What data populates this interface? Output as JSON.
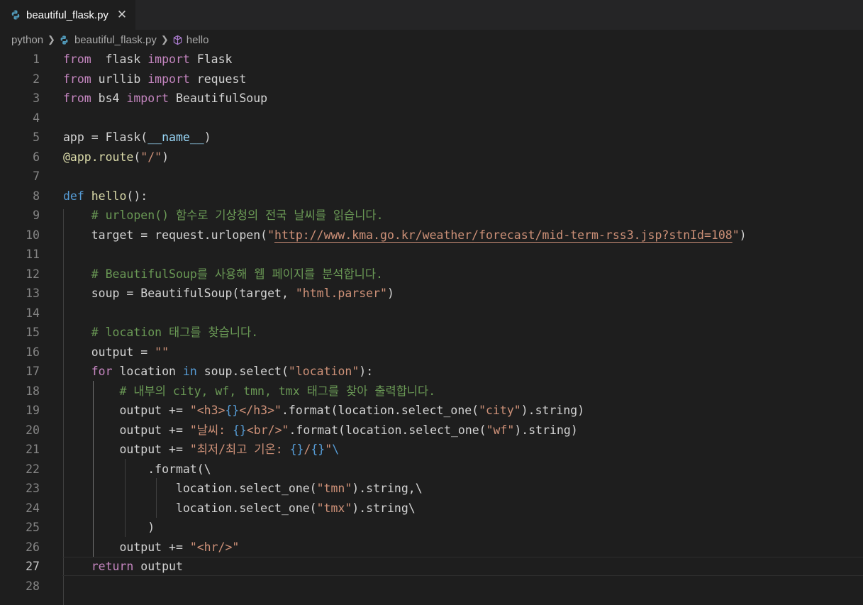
{
  "tab": {
    "filename": "beautiful_flask.py",
    "close_glyph": "✕",
    "icon": "python-icon"
  },
  "breadcrumb": {
    "folder": "python",
    "file": "beautiful_flask.py",
    "symbol": "hello"
  },
  "editor": {
    "current_line": 27,
    "lines": [
      {
        "n": "1",
        "tokens": [
          [
            "kw",
            "from"
          ],
          [
            "",
            "  flask "
          ],
          [
            "kw",
            "import"
          ],
          [
            "",
            " Flask"
          ]
        ]
      },
      {
        "n": "2",
        "tokens": [
          [
            "kw",
            "from"
          ],
          [
            "",
            " urllib "
          ],
          [
            "kw",
            "import"
          ],
          [
            "",
            " request"
          ]
        ]
      },
      {
        "n": "3",
        "tokens": [
          [
            "kw",
            "from"
          ],
          [
            "",
            " bs4 "
          ],
          [
            "kw",
            "import"
          ],
          [
            "",
            " BeautifulSoup"
          ]
        ]
      },
      {
        "n": "4",
        "tokens": []
      },
      {
        "n": "5",
        "tokens": [
          [
            "",
            "app = Flask("
          ],
          [
            "var",
            "__name__"
          ],
          [
            "",
            ")"
          ]
        ]
      },
      {
        "n": "6",
        "tokens": [
          [
            "fn",
            "@app.route"
          ],
          [
            "",
            "("
          ],
          [
            "str",
            "\"/\""
          ],
          [
            "",
            ")"
          ]
        ]
      },
      {
        "n": "7",
        "tokens": []
      },
      {
        "n": "8",
        "tokens": [
          [
            "kwb",
            "def"
          ],
          [
            "",
            " "
          ],
          [
            "fn",
            "hello"
          ],
          [
            "",
            "():"
          ]
        ]
      },
      {
        "n": "9",
        "tokens": [
          [
            "",
            "    "
          ],
          [
            "cm",
            "# urlopen() 함수로 기상청의 전국 날씨를 읽습니다."
          ]
        ]
      },
      {
        "n": "10",
        "tokens": [
          [
            "",
            "    target = request.urlopen("
          ],
          [
            "str",
            "\""
          ],
          [
            "str ul",
            "http://www.kma.go.kr/weather/forecast/mid-term-rss3.jsp?stnId=108"
          ],
          [
            "str",
            "\""
          ],
          [
            "",
            ")"
          ]
        ]
      },
      {
        "n": "11",
        "tokens": []
      },
      {
        "n": "12",
        "tokens": [
          [
            "",
            "    "
          ],
          [
            "cm",
            "# BeautifulSoup를 사용해 웹 페이지를 분석합니다."
          ]
        ]
      },
      {
        "n": "13",
        "tokens": [
          [
            "",
            "    soup = BeautifulSoup(target, "
          ],
          [
            "str",
            "\"html.parser\""
          ],
          [
            "",
            ")"
          ]
        ]
      },
      {
        "n": "14",
        "tokens": []
      },
      {
        "n": "15",
        "tokens": [
          [
            "",
            "    "
          ],
          [
            "cm",
            "# location 태그를 찾습니다."
          ]
        ]
      },
      {
        "n": "16",
        "tokens": [
          [
            "",
            "    output = "
          ],
          [
            "str",
            "\"\""
          ]
        ]
      },
      {
        "n": "17",
        "tokens": [
          [
            "",
            "    "
          ],
          [
            "kw",
            "for"
          ],
          [
            "",
            " location "
          ],
          [
            "kwb",
            "in"
          ],
          [
            "",
            " soup.select("
          ],
          [
            "str",
            "\"location\""
          ],
          [
            "",
            "):"
          ]
        ]
      },
      {
        "n": "18",
        "tokens": [
          [
            "",
            "        "
          ],
          [
            "cm",
            "# 내부의 city, wf, tmn, tmx 태그를 찾아 출력합니다."
          ]
        ]
      },
      {
        "n": "19",
        "tokens": [
          [
            "",
            "        output += "
          ],
          [
            "str",
            "\"<h3>"
          ],
          [
            "esc",
            "{}"
          ],
          [
            "str",
            "</h3>\""
          ],
          [
            "",
            ".format(location.select_one("
          ],
          [
            "str",
            "\"city\""
          ],
          [
            "",
            ").string)"
          ]
        ]
      },
      {
        "n": "20",
        "tokens": [
          [
            "",
            "        output += "
          ],
          [
            "str",
            "\"날씨: "
          ],
          [
            "esc",
            "{}"
          ],
          [
            "str",
            "<br/>\""
          ],
          [
            "",
            ".format(location.select_one("
          ],
          [
            "str",
            "\"wf\""
          ],
          [
            "",
            ").string)"
          ]
        ]
      },
      {
        "n": "21",
        "tokens": [
          [
            "",
            "        output += "
          ],
          [
            "str",
            "\"최저/최고 기온: "
          ],
          [
            "esc",
            "{}"
          ],
          [
            "str",
            "/"
          ],
          [
            "esc",
            "{}"
          ],
          [
            "str",
            "\""
          ],
          [
            "esc",
            "\\"
          ]
        ]
      },
      {
        "n": "22",
        "tokens": [
          [
            "",
            "            .format(\\"
          ]
        ]
      },
      {
        "n": "23",
        "tokens": [
          [
            "",
            "                location.select_one("
          ],
          [
            "str",
            "\"tmn\""
          ],
          [
            "",
            ").string,\\"
          ]
        ]
      },
      {
        "n": "24",
        "tokens": [
          [
            "",
            "                location.select_one("
          ],
          [
            "str",
            "\"tmx\""
          ],
          [
            "",
            ").string\\"
          ]
        ]
      },
      {
        "n": "25",
        "tokens": [
          [
            "",
            "            )"
          ]
        ]
      },
      {
        "n": "26",
        "tokens": [
          [
            "",
            "        output += "
          ],
          [
            "str",
            "\"<hr/>\""
          ]
        ]
      },
      {
        "n": "27",
        "tokens": [
          [
            "",
            "    "
          ],
          [
            "kw",
            "return"
          ],
          [
            "",
            " output"
          ]
        ]
      },
      {
        "n": "28",
        "tokens": []
      }
    ]
  }
}
